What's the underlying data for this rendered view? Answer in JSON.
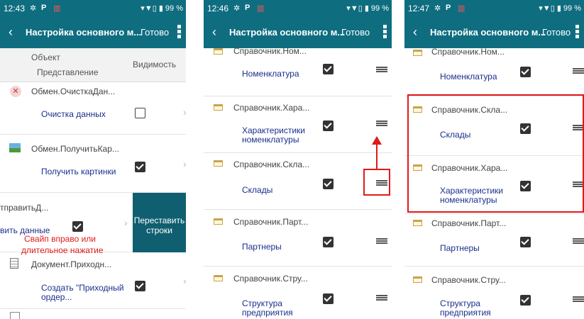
{
  "panel1": {
    "time": "12:43",
    "status_right": "▾▼▯ ▮ 99 %",
    "title": "Настройка основного м...",
    "done": "Готово",
    "header": {
      "object": "Объект",
      "representation": "Представление",
      "visibility": "Видимость"
    },
    "rows": [
      {
        "object": "Обмен.ОчисткаДан...",
        "rep": "Очистка данных",
        "checked": false,
        "icon": "delete-icon"
      },
      {
        "object": "Обмен.ПолучитьКар...",
        "rep": "Получить картинки",
        "checked": true,
        "icon": "picture-icon"
      },
      {
        "object": "тправитьД...",
        "rep": "вить данные",
        "checked": true
      },
      {
        "object": "Документ.Приходн...",
        "rep": "Создать \"Приходный ордер...",
        "checked": true,
        "icon": "document-icon"
      }
    ],
    "swipe_action": "Переставить строки",
    "annotation_line1": "Свайп вправо или",
    "annotation_line2": "длительное нажатие"
  },
  "panel2": {
    "time": "12:46",
    "status_right": "▾▼▯ ▮ 99 %",
    "title": "Настройка основного м...",
    "done": "Готово",
    "rows": [
      {
        "object": "Справочник.Ном...",
        "rep": "Номенклатура",
        "checked": true
      },
      {
        "object": "Справочник.Хара...",
        "rep": "Характеристики номенклатуры",
        "checked": true
      },
      {
        "object": "Справочник.Скла...",
        "rep": "Склады",
        "checked": true
      },
      {
        "object": "Справочник.Парт...",
        "rep": "Партнеры",
        "checked": true
      },
      {
        "object": "Справочник.Стру...",
        "rep": "Структура предприятия",
        "checked": true
      }
    ]
  },
  "panel3": {
    "time": "12:47",
    "status_right": "▾▼▯ ▮ 99 %",
    "title": "Настройка основного м...",
    "done": "Готово",
    "rows": [
      {
        "object": "Справочник.Ном...",
        "rep": "Номенклатура",
        "checked": true
      },
      {
        "object": "Справочник.Скла...",
        "rep": "Склады",
        "checked": true
      },
      {
        "object": "Справочник.Хара...",
        "rep": "Характеристики номенклатуры",
        "checked": true
      },
      {
        "object": "Справочник.Парт...",
        "rep": "Партнеры",
        "checked": true
      },
      {
        "object": "Справочник.Стру...",
        "rep": "Структура предприятия",
        "checked": true
      }
    ]
  },
  "colors": {
    "bar": "#0f6d80",
    "link": "#1a2f8c",
    "annotation": "#e01a1a"
  }
}
